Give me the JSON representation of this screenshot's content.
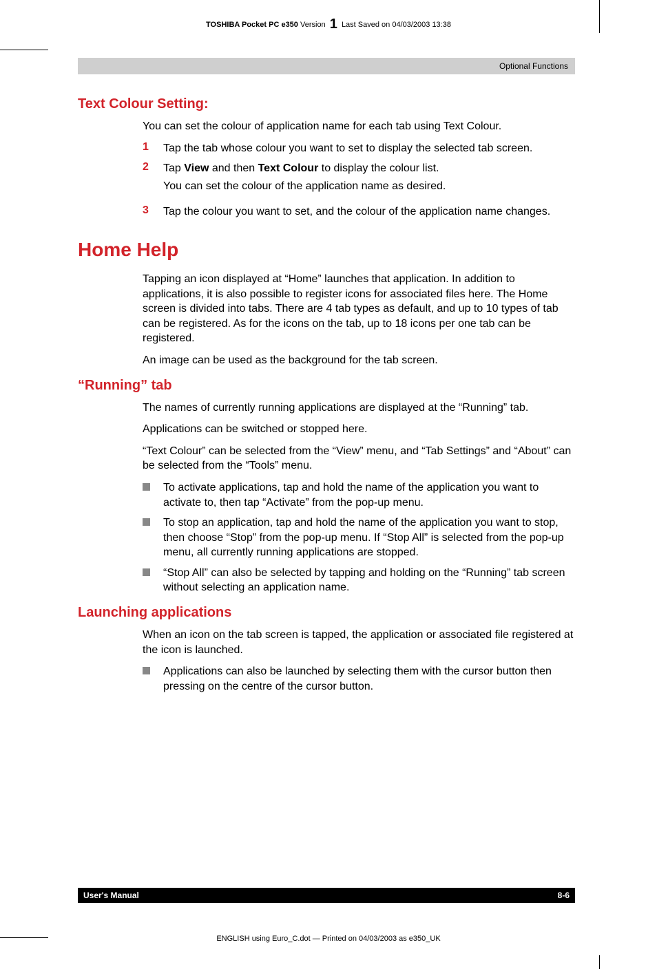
{
  "header": {
    "product": "TOSHIBA Pocket PC e350",
    "version_label": "Version",
    "version_num": "1",
    "saved": "Last Saved on 04/03/2003 13:38"
  },
  "graybar": {
    "text": "Optional Functions"
  },
  "section1": {
    "title": "Text Colour Setting:",
    "intro": "You can set the colour of application name for each tab using Text Colour.",
    "steps": [
      {
        "n": "1",
        "text": "Tap the tab whose colour you want to set to display the selected tab screen."
      },
      {
        "n": "2",
        "text_pre": "Tap ",
        "b1": "View",
        "mid": " and then ",
        "b2": "Text Colour",
        "text_post": " to display the colour list.",
        "sub": "You can set the colour of the application name as desired."
      },
      {
        "n": "3",
        "text": "Tap the colour you want to set, and the colour of the application name changes."
      }
    ]
  },
  "section2": {
    "title": "Home Help",
    "p1": "Tapping an icon displayed at “Home” launches that application. In addition to applications, it is also possible to register icons for associated files here. The Home screen is divided into tabs. There are 4 tab types as default, and up to 10 types of tab can be registered. As for the icons on the tab, up to 18 icons per one tab can be registered.",
    "p2": "An image can be used as the background for the tab screen."
  },
  "section3": {
    "title": "“Running” tab",
    "p1": "The names of currently running applications are displayed at the “Running” tab.",
    "p2": "Applications can be switched or stopped here.",
    "p3": "“Text Colour” can be selected from the “View” menu, and “Tab Settings” and “About” can be selected from the “Tools” menu.",
    "bullets": [
      "To activate applications, tap and hold the name of the application you want to activate to, then tap “Activate” from the pop-up menu.",
      "To stop an application, tap and hold the name of the application you want to stop, then choose “Stop” from the pop-up menu. If “Stop All” is selected from the pop-up menu, all currently running applications are stopped.",
      "“Stop All” can also be selected by tapping and holding on the “Running” tab screen without selecting an application name."
    ]
  },
  "section4": {
    "title": "Launching applications",
    "p1": "When an icon on the tab screen is tapped, the application or associated file registered at the icon is launched.",
    "bullets": [
      "Applications can also be launched by selecting them with the cursor button then pressing on the centre of the cursor button."
    ]
  },
  "footer": {
    "left": "User's Manual",
    "right": "8-6"
  },
  "bottom": "ENGLISH using  Euro_C.dot — Printed on 04/03/2003 as e350_UK"
}
